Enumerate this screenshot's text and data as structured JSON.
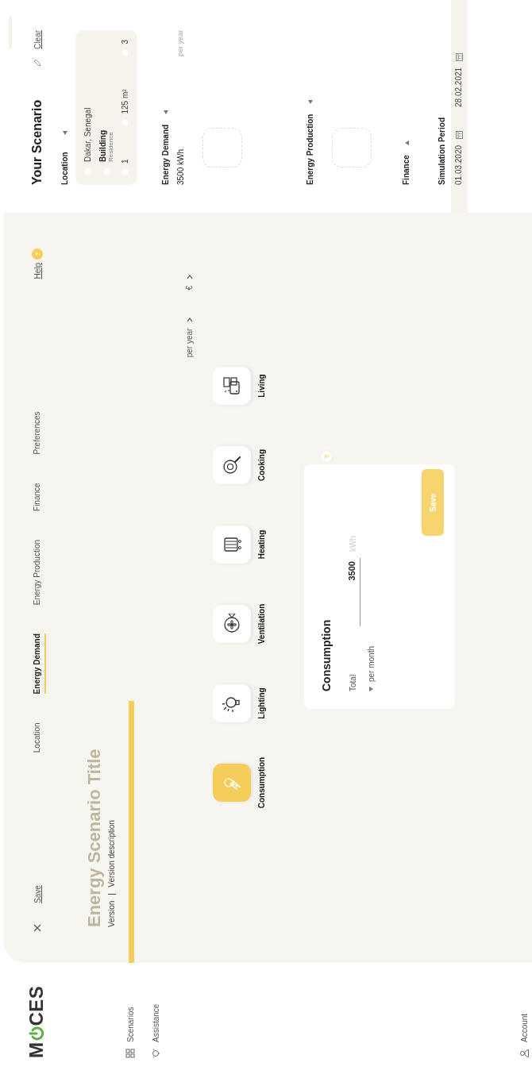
{
  "sidebar": {
    "logo_start": "M",
    "logo_end": "CES",
    "nav": [
      {
        "label": "Scenarios"
      },
      {
        "label": "Assistance"
      }
    ],
    "account": "Account"
  },
  "toolbar": {
    "save": "Save",
    "tabs": [
      {
        "label": "Location",
        "selected": false
      },
      {
        "label": "Energy Demand",
        "selected": true
      },
      {
        "label": "Energy Production",
        "selected": false
      },
      {
        "label": "Finance",
        "selected": false
      },
      {
        "label": "Preferences",
        "selected": false
      }
    ],
    "help": "Help",
    "help_badge": "?"
  },
  "scenario": {
    "title": "Energy Scenario Title",
    "version": "Version",
    "description": "Version description"
  },
  "units": [
    {
      "label": "per year"
    },
    {
      "label": "€"
    }
  ],
  "categories": [
    {
      "label": "Consumption",
      "selected": true
    },
    {
      "label": "Lighting",
      "selected": false
    },
    {
      "label": "Ventilation",
      "selected": false
    },
    {
      "label": "Heating",
      "selected": false
    },
    {
      "label": "Cooking",
      "selected": false
    },
    {
      "label": "Living",
      "selected": false
    }
  ],
  "form": {
    "title": "Consumption",
    "help": "?",
    "total_label": "Total",
    "value": "3500",
    "unit": "kWh",
    "toggle": "per month",
    "button": "Save"
  },
  "summary": {
    "title": "Your Scenario",
    "clear": "Clear",
    "sections": [
      {
        "kind": "location",
        "title": "Location",
        "expanded": true,
        "place": "Dakar, Senegal",
        "building": "Building",
        "building_type": "Residence",
        "stats": [
          "1",
          "125 m²",
          "3"
        ]
      },
      {
        "kind": "demand",
        "title": "Energy Demand",
        "expanded": true,
        "value": "3500 kWh",
        "period": "per year"
      },
      {
        "kind": "production",
        "title": "Energy Production",
        "expanded": true
      },
      {
        "kind": "finance",
        "title": "Finance",
        "expanded": false
      },
      {
        "kind": "period",
        "title": "Simulation Period",
        "dates": [
          "01.03.2020",
          "28.02.2021"
        ]
      }
    ]
  }
}
